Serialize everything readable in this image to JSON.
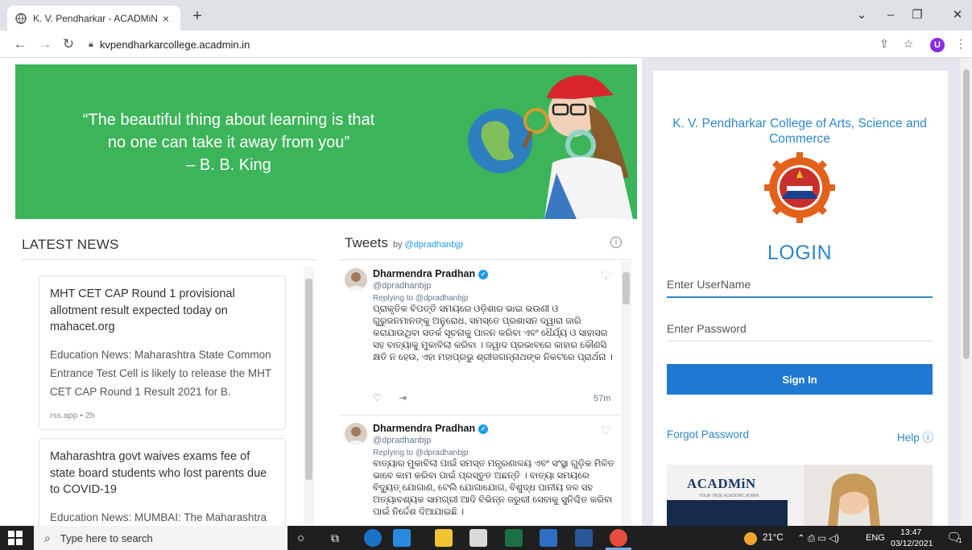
{
  "browser": {
    "tab_title": "K. V. Pendharkar - ACADMiN",
    "tab_close": "×",
    "new_tab": "+",
    "url": "kvpendharkarcollege.acadmin.in",
    "profile_initial": "U",
    "window_controls": {
      "dropdown": "⌄",
      "minimize": "–",
      "restore": "❐",
      "close": "✕"
    }
  },
  "banner": {
    "quote_line1": "“The beautiful thing about learning is that",
    "quote_line2": "no one can take it away from you”",
    "quote_line3": "– B. B. King"
  },
  "news": {
    "title": "LATEST NEWS",
    "items": [
      {
        "headline": "MHT CET CAP Round 1 provisional allotment result expected today on mahacet.org",
        "body": "Education News: Maharashtra State Common Entrance Test Cell is likely to release the MHT CET CAP Round 1 Result 2021 for B.",
        "meta": "rss.app • 2h"
      },
      {
        "headline": "Maharashtra govt waives exams fee of state board students who lost parents due to COVID-19",
        "body": "Education News: MUMBAI: The Maharashtra",
        "meta": ""
      }
    ]
  },
  "tweets": {
    "title": "Tweets",
    "by_prefix": "by",
    "by_handle": "@dpradhanbjp",
    "info": "i",
    "items": [
      {
        "name": "Dharmendra Pradhan",
        "handle": "@dpradhanbjp",
        "reply_to": "Replying to @dpradhanbjp",
        "text": "ପ୍ରାକୃତିକ ବିପତ୍ତି ସମୟରେ ଓଡ଼ିଶାର ଭାଇ ଭଉଣୀ ଓ ଗୁରୁଜନମାନଙ୍କୁ ଅନୁରୋଧ, ସମସ୍ତେ ପ୍ରଶାସନ ଦ୍ୱାରା ଜାରି କରାଯାଉଥିବା ସତର୍କ ସୂଚନାକୁ ପାଳନ କରିବା ଏବଂ ଧୈର୍ଯ୍ୟ ଓ ସାହାସର ସହ ବାତ୍ୟାକୁ ମୁକାବିଲା କରିବା । ଜୱାଦ ପ୍ରଭାବରେ କାହାର କୌଣସି କ୍ଷତି ନ ହେଉ, ଏହା ମହାପ୍ରଭୁ ଶ୍ରୀଜଗନ୍ନାଥଙ୍କ ନିକଟରେ ପ୍ରାର୍ଥନା ।",
        "time": "57m"
      },
      {
        "name": "Dharmendra Pradhan",
        "handle": "@dpradhanbjp",
        "reply_to": "Replying to @dpradhanbjp",
        "text": "ବାତ୍ୟାର ମୁକାବିଲା ପାଇଁ ସମସ୍ତ ମନ୍ତ୍ରଣାଳୟ ଏବଂ ସଂସ୍ଥା ଗୁଡ଼ିକ ମିଳିତ ଭାବେ କାମ କରିବା ପାଇଁ ପ୍ରସ୍ତୁତ ଅଛନ୍ତି । ବାତ୍ୟା ସମୟରେ ବିଦ୍ୟୁତ୍ ଯୋଗାଣ, ଟେଲି ଯୋଗାଯୋଗ, ବିଶୁଦ୍ଧ ପାନୀୟ ଜଳ ସହ ଅତ୍ୟାବଶ୍ୟକ ସାମଗ୍ରୀ ଆଦି ବିଭିନ୍ନ ଜରୁରୀ ସେବାକୁ ସୁନିଶ୍ଚିତ କରିବା ପାଇଁ ନିର୍ଦ୍ଦେଶ ଦିଆଯାଇଛି ।",
        "time": ""
      }
    ]
  },
  "login": {
    "college_name": "K. V. Pendharkar College of Arts, Science and Commerce",
    "title": "LOGIN",
    "username_placeholder": "Enter UserName",
    "password_placeholder": "Enter Password",
    "signin_label": "Sign In",
    "forgot_label": "Forgot Password",
    "help_label": "Help ⓘ",
    "ad_brand": "ACADMiN",
    "ad_tagline": "YOUR TRUE ACADEMIC ADMIN"
  },
  "taskbar": {
    "search_placeholder": "Type here to search",
    "weather": "21°C",
    "language": "ENG",
    "time": "13:47",
    "date": "03/12/2021",
    "notif_count": "1"
  },
  "colors": {
    "banner_green": "#3cb45a",
    "accent_blue": "#2f86c9",
    "signin_blue": "#1f78d1"
  }
}
